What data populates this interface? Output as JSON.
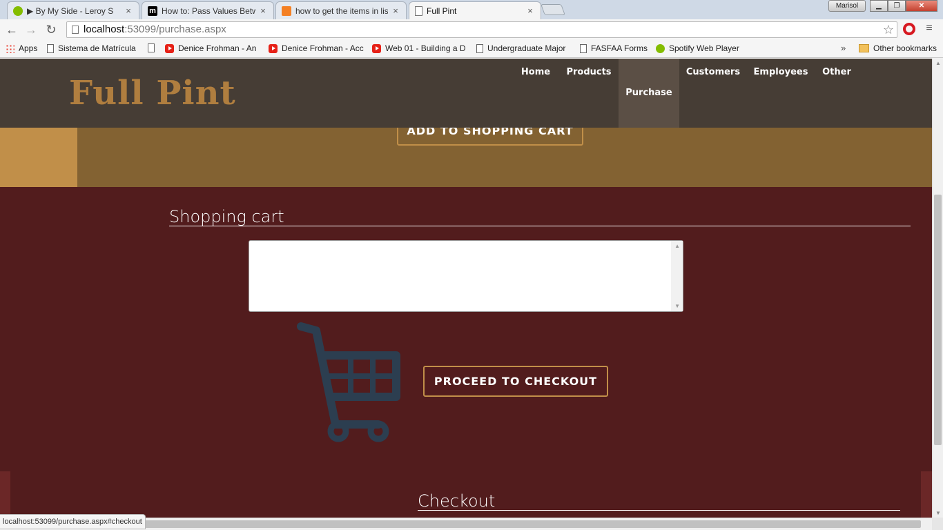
{
  "browser": {
    "tabs": [
      {
        "title": "▶ By My Side - Leroy S",
        "close": "×"
      },
      {
        "title": "How to: Pass Values Betwe",
        "close": "×"
      },
      {
        "title": "how to get the items in lis",
        "close": "×"
      },
      {
        "title": "Full Pint",
        "close": "×"
      }
    ],
    "profile_name": "Marisol",
    "url_host": "localhost",
    "url_path": ":53099/purchase.aspx",
    "bookmarks": [
      "Apps",
      "Sistema de Matrícula",
      "",
      "Denice Frohman - An",
      "Denice Frohman - Acc",
      "Web 01 - Building a D",
      "Undergraduate Major",
      "FASFAA Forms",
      "Spotify Web Player"
    ],
    "bookmarks_overflow": "»",
    "other_bookmarks": "Other bookmarks",
    "status_url": "localhost:53099/purchase.aspx#checkout"
  },
  "site": {
    "logo": "Full Pint",
    "nav": [
      "Home",
      "Products",
      "Purchase",
      "Customers",
      "Employees",
      "Other"
    ],
    "active_nav": "Purchase",
    "add_to_cart_button": "ADD TO SHOPPING CART",
    "shopping_cart_heading": "Shopping cart",
    "checkout_button": "PROCEED TO CHECKOUT",
    "checkout_heading": "Checkout"
  },
  "colors": {
    "header_bg": "#463d35",
    "accent_gold": "#c18f49",
    "band": "#836232",
    "main_bg": "#521c1d",
    "cart_icon": "#2c3e50"
  }
}
